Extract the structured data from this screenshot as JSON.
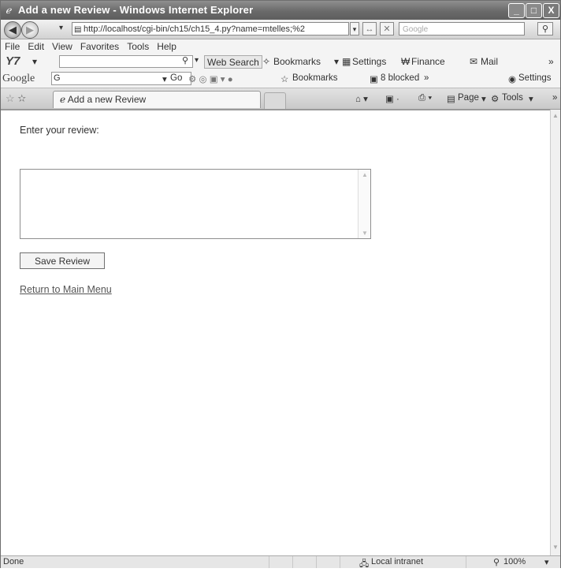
{
  "window": {
    "title": "Add a new Review - Windows Internet Explorer",
    "minimize": "_",
    "maximize": "□",
    "close": "X"
  },
  "address_bar": {
    "url": "http://localhost/cgi-bin/ch15/ch15_4.py?name=mtelles;%2",
    "search_placeholder": "Google"
  },
  "menu": [
    "File",
    "Edit",
    "View",
    "Favorites",
    "Tools",
    "Help"
  ],
  "yahoo_toolbar": {
    "logo": "Y7",
    "search_button": "Web Search",
    "items": [
      "Bookmarks",
      "Settings",
      "Finance",
      "Mail"
    ]
  },
  "google_toolbar": {
    "logo": "Google",
    "input_text": "G",
    "items": [
      "Go",
      "Bookmarks",
      "8 blocked",
      "Settings"
    ]
  },
  "tabs": {
    "active_label": "Add a new Review",
    "commands": [
      "Page",
      "Tools"
    ]
  },
  "page": {
    "prompt": "Enter your review:",
    "textarea_value": "",
    "save_button": "Save Review",
    "return_link": "Return to Main Menu"
  },
  "status_bar": {
    "text": "Done",
    "zone": "Local intranet",
    "zoom": "100%"
  }
}
